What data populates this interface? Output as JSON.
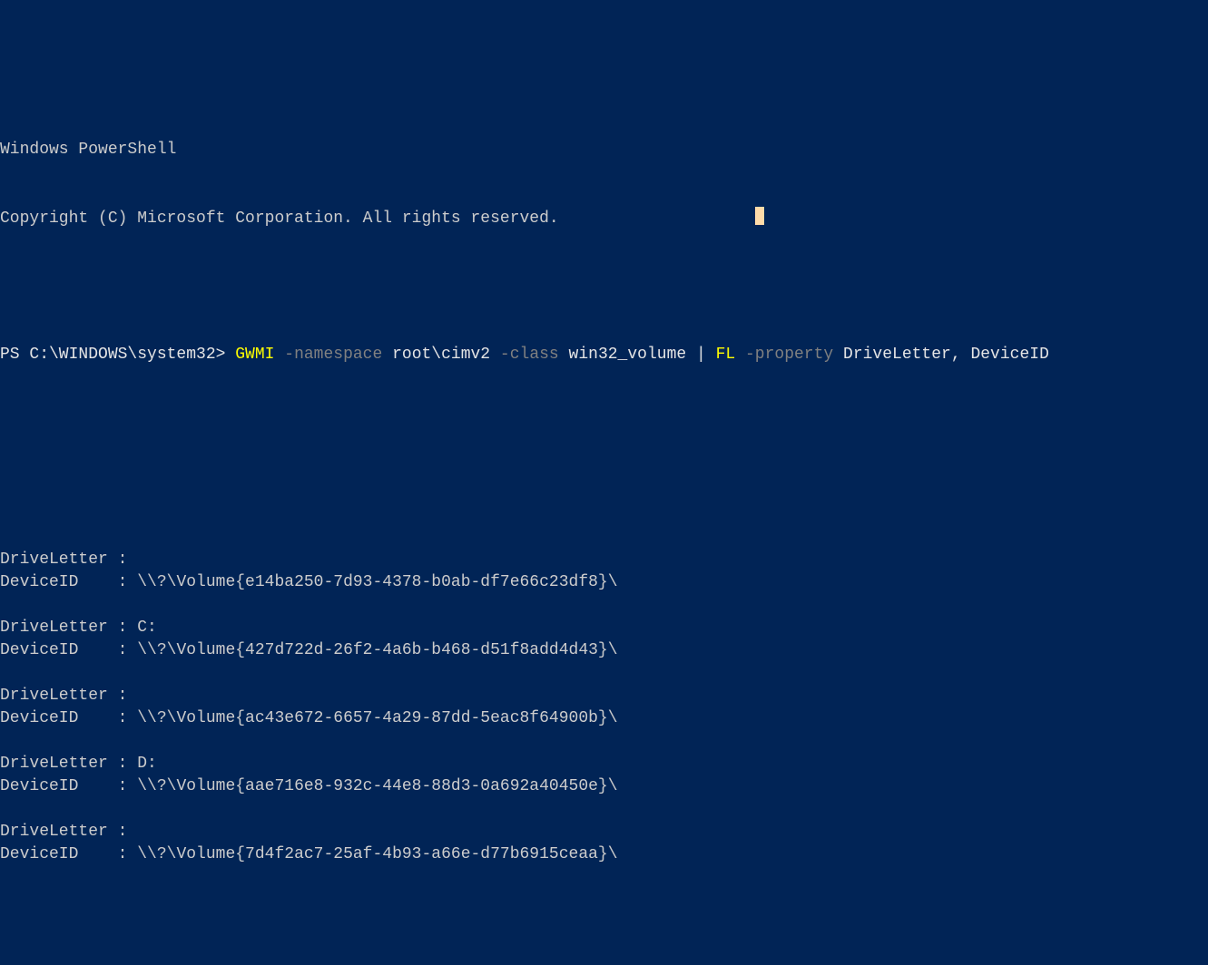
{
  "header": {
    "title": "Windows PowerShell",
    "copyright": "Copyright (C) Microsoft Corporation. All rights reserved."
  },
  "prompt": {
    "prefix": "PS C:\\WINDOWS\\system32> ",
    "cmd1": "GWMI",
    "param1": " -namespace ",
    "arg1": "root\\cimv2",
    "param2": " -class ",
    "arg2": "win32_volume",
    "pipe": " | ",
    "cmd2": "FL",
    "param3": " -property ",
    "arg3": "DriveLetter",
    "comma": ", ",
    "arg4": "DeviceID"
  },
  "output": {
    "labelDriveLetter": "DriveLetter",
    "labelDeviceID": "DeviceID   ",
    "sep": " : ",
    "records": [
      {
        "driveLetter": "",
        "deviceID": "\\\\?\\Volume{e14ba250-7d93-4378-b0ab-df7e66c23df8}\\"
      },
      {
        "driveLetter": "C:",
        "deviceID": "\\\\?\\Volume{427d722d-26f2-4a6b-b468-d51f8add4d43}\\"
      },
      {
        "driveLetter": "",
        "deviceID": "\\\\?\\Volume{ac43e672-6657-4a29-87dd-5eac8f64900b}\\"
      },
      {
        "driveLetter": "D:",
        "deviceID": "\\\\?\\Volume{aae716e8-932c-44e8-88d3-0a692a40450e}\\"
      },
      {
        "driveLetter": "",
        "deviceID": "\\\\?\\Volume{7d4f2ac7-25af-4b93-a66e-d77b6915ceaa}\\"
      }
    ]
  }
}
